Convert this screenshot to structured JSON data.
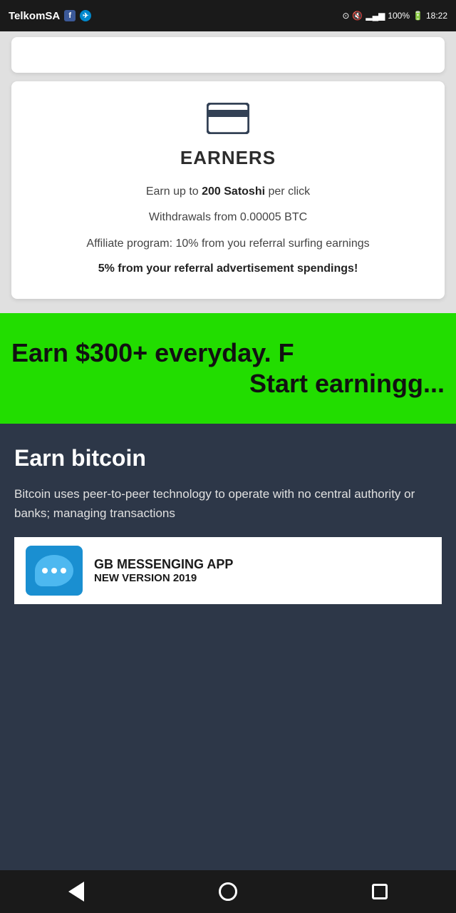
{
  "statusBar": {
    "carrier": "TelkomSA",
    "battery": "100%",
    "time": "18:22"
  },
  "earnerCard": {
    "title": "EARNERS",
    "line1_prefix": "Earn up to ",
    "line1_bold": "200 Satoshi",
    "line1_suffix": " per click",
    "line2": "Withdrawals from 0.00005 BTC",
    "line3": "Affiliate program: 10% from you referral surfing earnings",
    "line4": "5% from your referral advertisement spendings!"
  },
  "adBanner": {
    "line1": "Earn $300+ everyday. F",
    "line2": "Start earning"
  },
  "bitcoinSection": {
    "title": "Earn bitcoin",
    "description": "Bitcoin uses peer-to-peer technology to operate with no central authority or banks; managing transactions"
  },
  "appPromo": {
    "title": "GB MESSENGING APP",
    "subtitle": "NEW VERSION 2019"
  },
  "nav": {
    "back": "back",
    "home": "home",
    "recents": "recents"
  }
}
